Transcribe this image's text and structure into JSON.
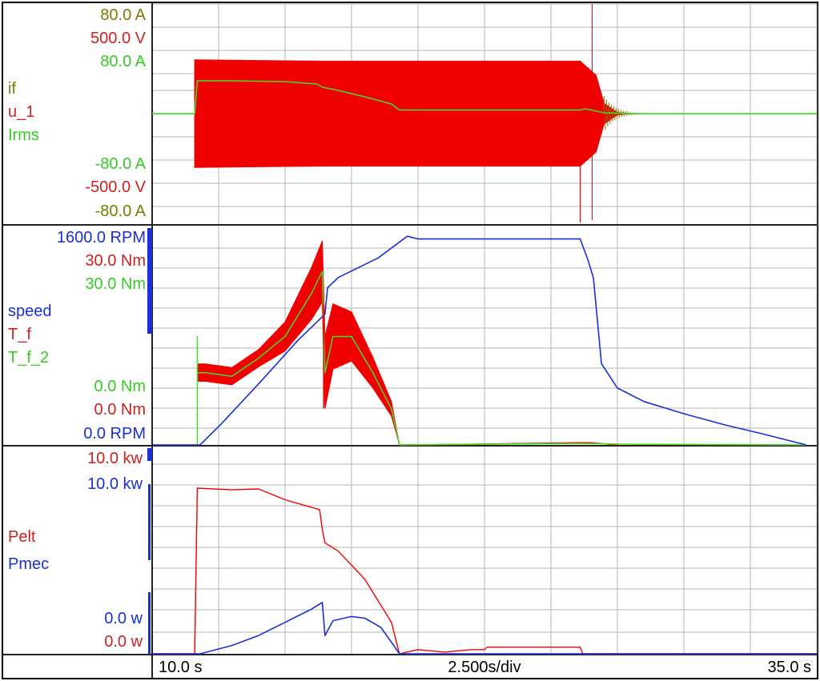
{
  "colors": {
    "olive": "#7a7a00",
    "red": "#f00000",
    "green": "#44dd22",
    "blue": "#1a2fd6",
    "grid": "#b4b4b4",
    "frame": "#000000"
  },
  "panels": {
    "top": {
      "scale_labels_top": [
        "80.0  A",
        "500.0  V",
        "80.0  A"
      ],
      "scale_labels_bottom": [
        "-80.0  A",
        "-500.0  V",
        "-80.0  A"
      ],
      "trace_names": [
        "if",
        "u_1",
        "Irms"
      ]
    },
    "middle": {
      "scale_labels_top": [
        "1600.0  RPM",
        "30.0  Nm",
        "30.0  Nm"
      ],
      "scale_labels_bottom": [
        "0.0  Nm",
        "0.0  Nm",
        "0.0  RPM"
      ],
      "trace_names": [
        "speed",
        "T_f",
        "T_f_2"
      ]
    },
    "bottom": {
      "scale_labels_top": [
        "10.0  kw",
        "10.0  kw"
      ],
      "scale_labels_bottom": [
        "0.0   w",
        "0.0   w"
      ],
      "trace_names": [
        "Pelt",
        "Pmec"
      ]
    }
  },
  "time_axis": {
    "start": "10.0  s",
    "div": "2.500s/div",
    "end": "35.0  s"
  },
  "chart_data": [
    {
      "type": "line",
      "panel": "top",
      "x_unit": "s",
      "xlim": [
        10.0,
        35.0
      ],
      "series": [
        {
          "name": "if",
          "unit": "A",
          "range": [
            -80,
            80
          ],
          "color": "#7a7a00",
          "envelope_t": [
            11.6,
            13.0,
            15.0,
            16.4,
            18.0
          ],
          "envelope_amp": [
            62,
            60,
            53,
            44,
            38
          ]
        },
        {
          "name": "u_1",
          "unit": "V",
          "range": [
            -500,
            500
          ],
          "color": "#f00000",
          "envelope_t": [
            11.6,
            16.4,
            26.1,
            26.7,
            27.0,
            27.5,
            28.0
          ],
          "envelope_amp": [
            420,
            410,
            410,
            300,
            80,
            10,
            0
          ]
        },
        {
          "name": "Irms",
          "unit": "A",
          "range": [
            -80,
            80
          ],
          "color": "#44dd22",
          "t": [
            10.0,
            11.6,
            11.7,
            13.0,
            15.0,
            16.2,
            16.4,
            17.0,
            18.0,
            19.0,
            19.3,
            26.1,
            26.3,
            26.6,
            27.0,
            28.0,
            35.0
          ],
          "v": [
            0,
            0,
            41,
            41,
            40,
            37,
            33,
            29,
            21,
            12,
            4.5,
            4.5,
            6,
            4,
            1,
            0,
            0
          ]
        }
      ]
    },
    {
      "type": "line",
      "panel": "middle",
      "x_unit": "s",
      "xlim": [
        10.0,
        35.0
      ],
      "series": [
        {
          "name": "speed",
          "unit": "RPM",
          "range": [
            0,
            1600
          ],
          "color": "#1a2fd6",
          "t": [
            10.0,
            11.8,
            12.6,
            14.0,
            15.5,
            16.5,
            16.6,
            17.0,
            18.5,
            19.6,
            20.0,
            23.7,
            26.1,
            26.4,
            26.6,
            26.9,
            27.5,
            28.5,
            30.0,
            31.5,
            33.0,
            34.6
          ],
          "v": [
            0,
            0,
            155,
            450,
            775,
            965,
            1160,
            1235,
            1380,
            1540,
            1520,
            1520,
            1520,
            1360,
            1230,
            600,
            420,
            320,
            230,
            150,
            80,
            0
          ]
        },
        {
          "name": "T_f",
          "unit": "Nm",
          "range": [
            0,
            30
          ],
          "color": "#f00000",
          "t": [
            11.7,
            12.0,
            13.0,
            14.0,
            15.0,
            16.0,
            16.4,
            16.5,
            16.8,
            17.5,
            18.3,
            19.0,
            19.3,
            20.0,
            26.1,
            26.5,
            27.5
          ],
          "v": [
            10,
            10,
            9.5,
            12,
            15,
            21,
            24,
            10,
            15,
            15,
            10,
            5,
            0,
            0,
            0.3,
            0.3,
            0
          ]
        },
        {
          "name": "T_f_2",
          "unit": "Nm",
          "range": [
            0,
            30
          ],
          "color": "#44dd22",
          "t": [
            11.7,
            12.0,
            13.0,
            14.0,
            15.0,
            16.0,
            16.4,
            16.5,
            16.8,
            17.5,
            18.3,
            19.0,
            19.3,
            26.1,
            28.0,
            34.6
          ],
          "v": [
            10,
            10,
            9.5,
            12,
            15,
            21,
            24,
            10,
            15,
            15,
            10,
            5,
            0,
            0.2,
            0.1,
            0
          ]
        }
      ]
    },
    {
      "type": "line",
      "panel": "bottom",
      "x_unit": "s",
      "xlim": [
        10.0,
        35.0
      ],
      "series": [
        {
          "name": "Pelt",
          "unit": "W",
          "range": [
            0,
            10000
          ],
          "color": "#f00000",
          "t": [
            10.0,
            11.6,
            11.7,
            13.0,
            14.0,
            15.0,
            16.3,
            16.4,
            16.5,
            17.0,
            18.0,
            19.0,
            19.3,
            20.0,
            21.0,
            22.0,
            22.5,
            22.6,
            26.1,
            26.2,
            35.0
          ],
          "v": [
            0,
            0,
            10000,
            9900,
            9950,
            9300,
            8700,
            7500,
            6700,
            6200,
            4500,
            1900,
            0,
            250,
            100,
            250,
            250,
            400,
            400,
            0,
            0
          ]
        },
        {
          "name": "Pmec",
          "unit": "W",
          "range": [
            0,
            10000
          ],
          "color": "#1a2fd6",
          "t": [
            10.0,
            11.8,
            13.0,
            14.0,
            15.0,
            16.0,
            16.4,
            16.5,
            16.8,
            17.5,
            18.0,
            18.6,
            19.0,
            19.3,
            35.0
          ],
          "v": [
            0,
            0,
            500,
            1100,
            1900,
            2700,
            3100,
            1100,
            2000,
            2250,
            2150,
            1600,
            700,
            0,
            0
          ]
        }
      ]
    }
  ]
}
